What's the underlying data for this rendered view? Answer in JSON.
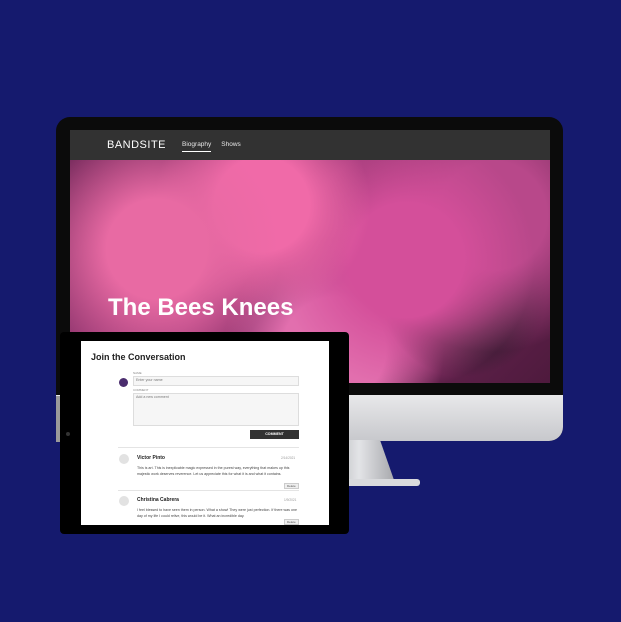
{
  "site": {
    "logo": "BANDSITE",
    "nav": [
      "Biography",
      "Shows"
    ],
    "hero_title": "The Bees Knees"
  },
  "conversation": {
    "title": "Join the Conversation",
    "name_label": "NAME",
    "name_placeholder": "Enter your name",
    "comment_label": "COMMENT",
    "comment_placeholder": "Add a new comment",
    "button": "COMMENT",
    "comments": [
      {
        "name": "Victor Pinto",
        "date": "2/14/2021",
        "text": "This is art. This is inexplicable magic expressed in the purest way, everything that makes up this majestic work deserves reverence. Let us appreciate this for what it is and what it contains.",
        "delete": "Delete"
      },
      {
        "name": "Christina Cabrera",
        "date": "1/9/2021",
        "text": "I feel blessed to have seen them in person. What a show! They were just perfection. If there was one day of my life I could relive, this would be it. What an incredible day.",
        "delete": "Delete"
      }
    ]
  }
}
